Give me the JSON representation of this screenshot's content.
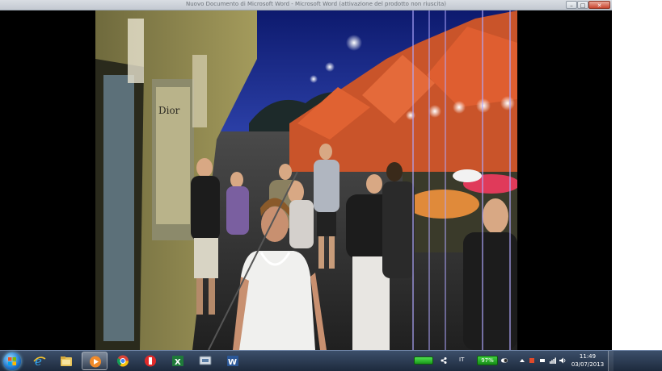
{
  "window": {
    "title": "Nuovo Documento di Microsoft Word - Microsoft Word (attivazione del prodotto non riuscita)",
    "minimize_label": "–",
    "maximize_label": "□",
    "close_label": "✕"
  },
  "video": {
    "storefront_sign": "Dior",
    "scene_colors": {
      "sky": "#1a2a8c",
      "tent": "#d7542a",
      "street": "#3a3a3a"
    }
  },
  "taskbar": {
    "start_icon": "windows-start-icon",
    "pinned": [
      {
        "name": "internet-explorer-icon",
        "active": false
      },
      {
        "name": "file-explorer-icon",
        "active": false
      },
      {
        "name": "media-player-icon",
        "active": true
      },
      {
        "name": "chrome-icon",
        "active": false
      },
      {
        "name": "red-app-icon",
        "active": false
      },
      {
        "name": "excel-icon",
        "active": false
      },
      {
        "name": "screen-tool-icon",
        "active": false
      },
      {
        "name": "word-icon",
        "active": false
      }
    ],
    "tray": {
      "language": "IT",
      "battery_percent": "97%",
      "time": "11:49",
      "date": "03/07/2013"
    }
  }
}
